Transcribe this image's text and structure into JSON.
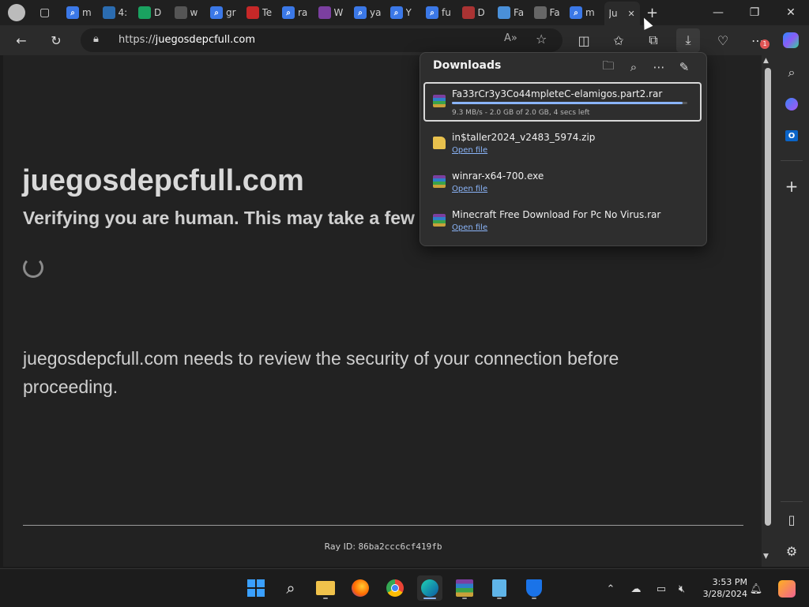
{
  "tabs": [
    {
      "label": "m",
      "icon": "search-icon",
      "color": "#3b78e7"
    },
    {
      "label": "4:",
      "icon": "app-4-icon",
      "color": "#2b6cb0"
    },
    {
      "label": "D",
      "icon": "opera-o-icon",
      "color": "#1aa260"
    },
    {
      "label": "w",
      "icon": "lock-page-icon",
      "color": "#555555"
    },
    {
      "label": "gr",
      "icon": "search-icon",
      "color": "#3b78e7"
    },
    {
      "label": "Te",
      "icon": "mail-icon",
      "color": "#c62828"
    },
    {
      "label": "ra",
      "icon": "search-icon",
      "color": "#3b78e7"
    },
    {
      "label": "W",
      "icon": "winrar-icon",
      "color": "#7b3fa0"
    },
    {
      "label": "ya",
      "icon": "search-icon",
      "color": "#3b78e7"
    },
    {
      "label": "Y",
      "icon": "search-icon",
      "color": "#3b78e7"
    },
    {
      "label": "fu",
      "icon": "search-icon",
      "color": "#3b78e7"
    },
    {
      "label": "D",
      "icon": "round-logo-icon",
      "color": "#a33"
    },
    {
      "label": "Fa",
      "icon": "loading-icon",
      "color": "#4a90d9"
    },
    {
      "label": "Fa",
      "icon": "document-icon",
      "color": "#666666"
    },
    {
      "label": "m",
      "icon": "search-icon",
      "color": "#3b78e7"
    },
    {
      "label": "Ju",
      "icon": "active-tab",
      "color": "#2b2b2b",
      "active": true
    }
  ],
  "address": {
    "prefix": "https://",
    "host": "juegosdepcfull.com"
  },
  "page": {
    "title": "juegosdepcfull.com",
    "verify": "Verifying you are human. This may take a few s",
    "review": "juegosdepcfull.com needs to review the security of your connection before proceeding.",
    "ray_label": "Ray ID:",
    "ray_id": "86ba2ccc6cf419fb"
  },
  "downloads": {
    "title": "Downloads",
    "items": [
      {
        "name": "Fa33rCr3y3Co44mpleteC-elamigos.part2.rar",
        "status": "9.3 MB/s - 2.0 GB of 2.0 GB, 4 secs left",
        "progress": 0.98,
        "type": "rar"
      },
      {
        "name": "in$taller2024_v2483_5974.zip",
        "link": "Open file",
        "type": "zip"
      },
      {
        "name": "winrar-x64-700.exe",
        "link": "Open file",
        "type": "rar"
      },
      {
        "name": "Minecraft Free Download For Pc No Virus.rar",
        "link": "Open file",
        "type": "rar"
      }
    ]
  },
  "toolbar": {
    "badge": "1"
  },
  "clock": {
    "time": "3:53 PM",
    "date": "3/28/2024"
  },
  "colors": {
    "accent": "#8ab4f8",
    "bg": "#222222"
  }
}
